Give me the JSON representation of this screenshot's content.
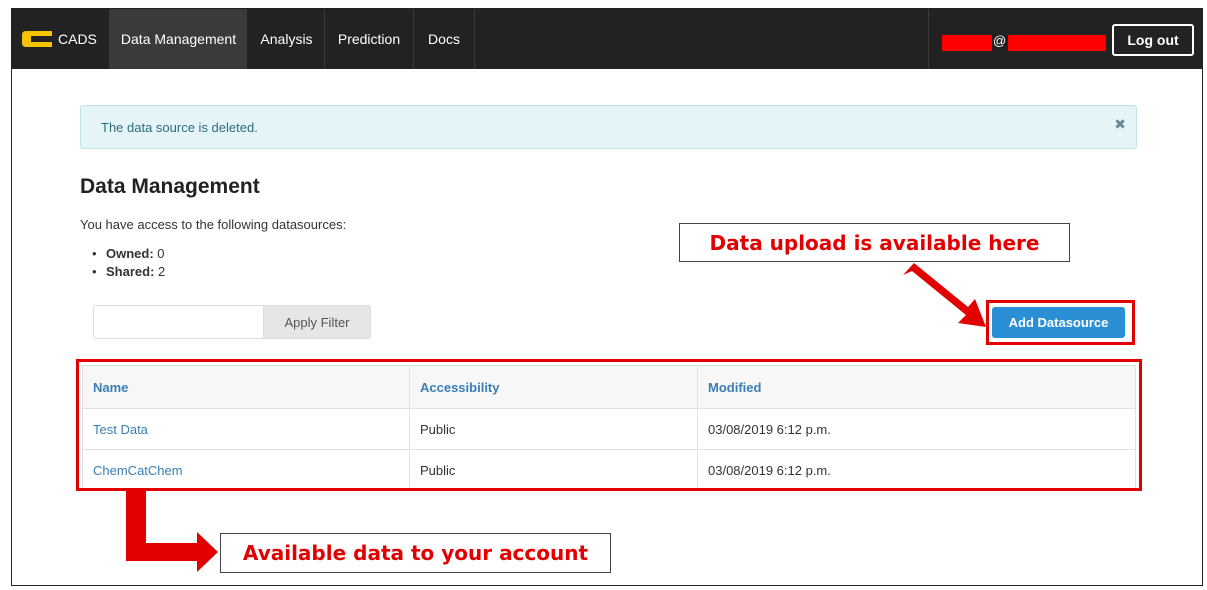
{
  "navbar": {
    "brand": "CADS",
    "items": [
      {
        "label": "Data Management",
        "active": true
      },
      {
        "label": "Analysis",
        "active": false
      },
      {
        "label": "Prediction",
        "active": false
      },
      {
        "label": "Docs",
        "active": false
      }
    ],
    "user_at": "@",
    "logout_label": "Log out"
  },
  "alert": {
    "message": "The data source is deleted.",
    "close_glyph": "✖"
  },
  "page": {
    "title": "Data Management",
    "access_text": "You have access to the following datasources:",
    "owned_label": "Owned:",
    "owned_count": "0",
    "shared_label": "Shared:",
    "shared_count": "2"
  },
  "filter": {
    "placeholder": "",
    "apply_label": "Apply Filter"
  },
  "add_label": "Add Datasource",
  "table": {
    "headers": [
      "Name",
      "Accessibility",
      "Modified"
    ],
    "rows": [
      [
        "Test Data",
        "Public",
        "03/08/2019 6:12 p.m."
      ],
      [
        "ChemCatChem",
        "Public",
        "03/08/2019 6:12 p.m."
      ]
    ]
  },
  "annotations": {
    "upload_callout": "Data upload is available here",
    "available_callout": "Available data to your account",
    "color": "#e30000"
  },
  "colors": {
    "navbar": "#222222",
    "accent": "#2b8fd6",
    "link": "#3a7fb5",
    "alert_bg": "#e5f5f7"
  }
}
